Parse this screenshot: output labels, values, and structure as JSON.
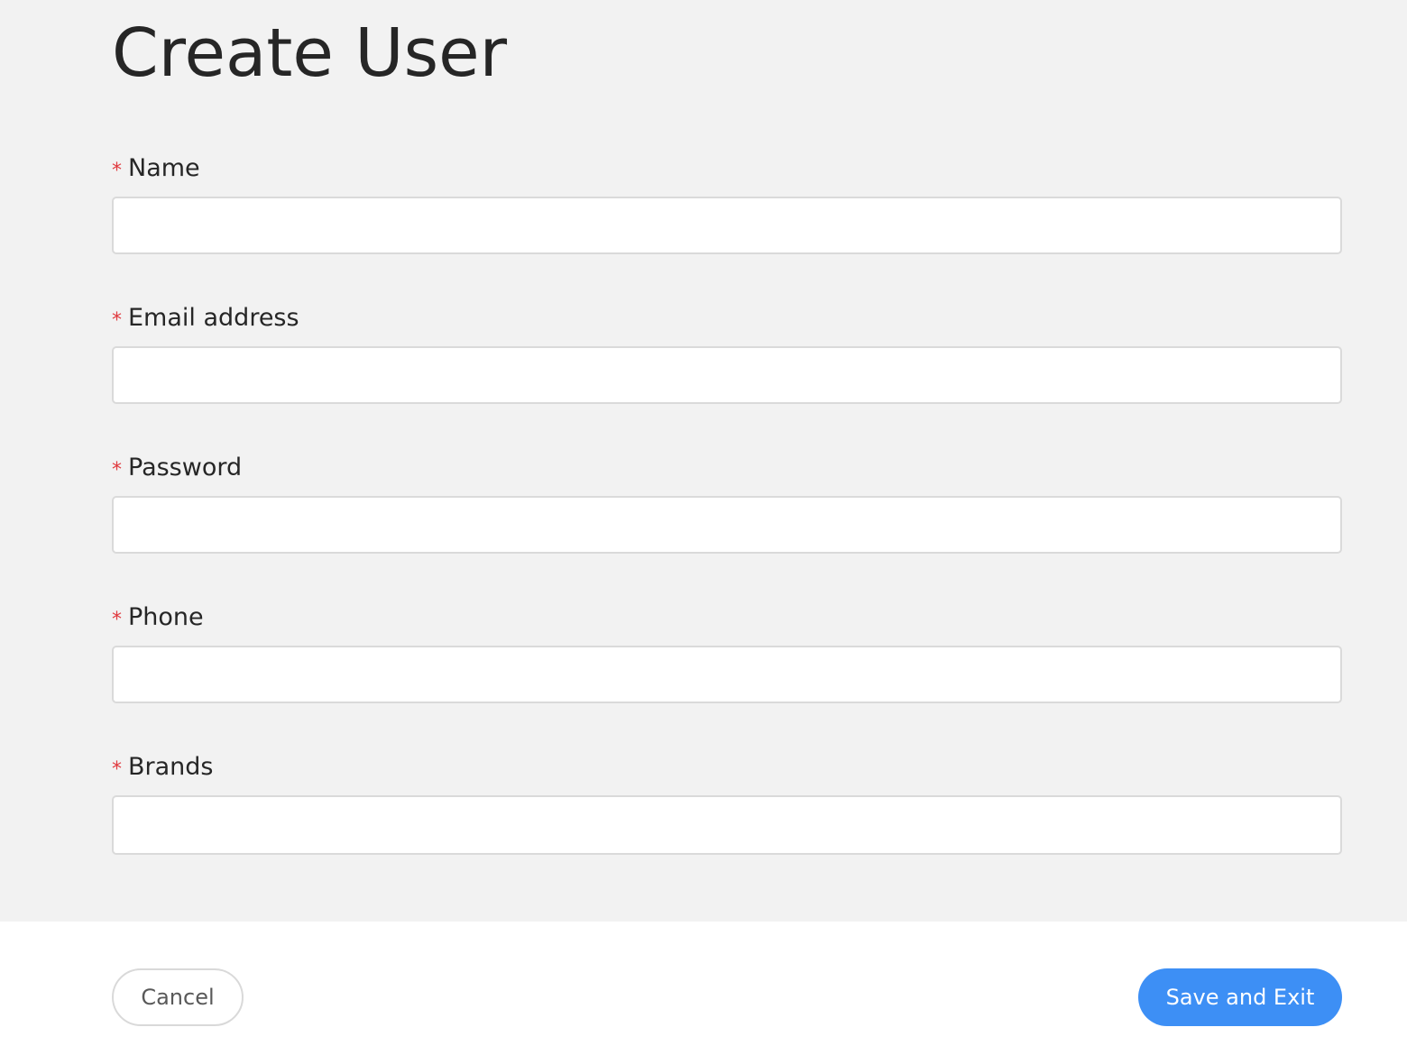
{
  "page": {
    "title": "Create User"
  },
  "form": {
    "required_mark": "*",
    "fields": [
      {
        "label": "Name",
        "value": "",
        "placeholder": ""
      },
      {
        "label": "Email address",
        "value": "",
        "placeholder": ""
      },
      {
        "label": "Password",
        "value": "",
        "placeholder": ""
      },
      {
        "label": "Phone",
        "value": "",
        "placeholder": ""
      },
      {
        "label": "Brands",
        "value": "",
        "placeholder": ""
      }
    ]
  },
  "footer": {
    "cancel_label": "Cancel",
    "save_label": "Save and Exit"
  },
  "colors": {
    "background": "#f2f2f2",
    "primary": "#3d8ff5",
    "required": "#e0393e",
    "border": "#dadada"
  }
}
